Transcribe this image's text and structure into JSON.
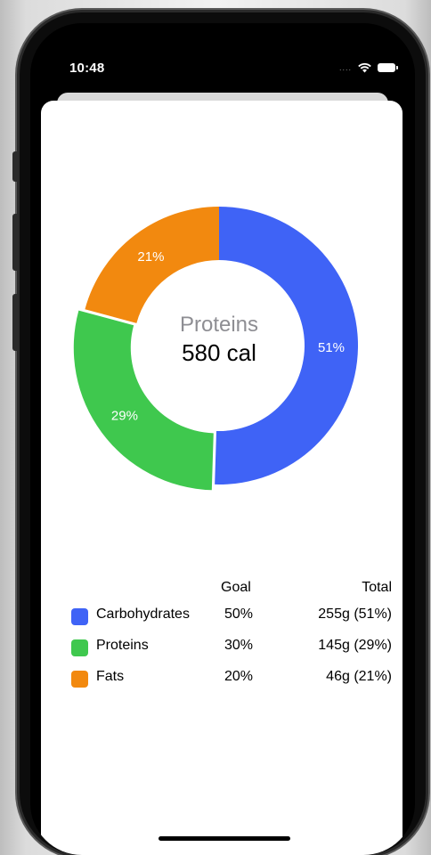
{
  "status_bar": {
    "time": "10:48",
    "signal": "....",
    "icons": [
      "wifi-icon",
      "battery-icon"
    ]
  },
  "chart_data": {
    "type": "pie",
    "style": "donut",
    "center_label": "Proteins",
    "center_value": "580 cal",
    "slices": [
      {
        "name": "Carbohydrates",
        "value": 51,
        "label": "51%",
        "color": "#3f63f6"
      },
      {
        "name": "Proteins",
        "value": 29,
        "label": "29%",
        "color": "#3fc84e"
      },
      {
        "name": "Fats",
        "value": 21,
        "label": "21%",
        "color": "#f2890f"
      }
    ],
    "highlighted": "Proteins"
  },
  "legend": {
    "goal_header": "Goal",
    "total_header": "Total",
    "rows": [
      {
        "name": "Carbohydrates",
        "goal": "50%",
        "total": "255g (51%)",
        "color": "#3f63f6"
      },
      {
        "name": "Proteins",
        "goal": "30%",
        "total": "145g (29%)",
        "color": "#3fc84e"
      },
      {
        "name": "Fats",
        "goal": "20%",
        "total": "46g (21%)",
        "color": "#f2890f"
      }
    ]
  }
}
